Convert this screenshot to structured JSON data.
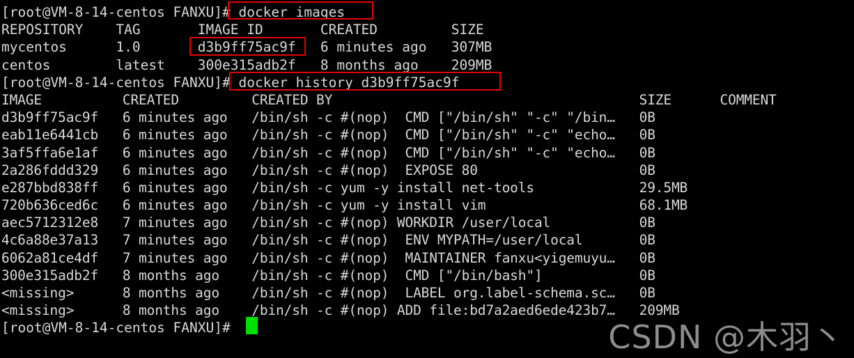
{
  "terminal": {
    "colors": {
      "background": "#000000",
      "foreground": "#d9d9d9",
      "cursor": "#00e000",
      "annotation": "#e60000",
      "watermark": "#9a9a9a"
    },
    "prompt": "[root@VM-8-14-centos FANXU]#",
    "lines": [
      "[root@VM-8-14-centos FANXU]# docker images",
      "REPOSITORY    TAG       IMAGE ID       CREATED         SIZE",
      "mycentos      1.0       d3b9ff75ac9f   6 minutes ago   307MB",
      "centos        latest    300e315adb2f   8 months ago    209MB",
      "[root@VM-8-14-centos FANXU]# docker history d3b9ff75ac9f",
      "IMAGE          CREATED         CREATED BY                                      SIZE      COMMENT",
      "d3b9ff75ac9f   6 minutes ago   /bin/sh -c #(nop)  CMD [\"/bin/sh\" \"-c\" \"/bin…   0B",
      "eab11e6441cb   6 minutes ago   /bin/sh -c #(nop)  CMD [\"/bin/sh\" \"-c\" \"echo…   0B",
      "3af5ffa6e1af   6 minutes ago   /bin/sh -c #(nop)  CMD [\"/bin/sh\" \"-c\" \"echo…   0B",
      "2a286fddd329   6 minutes ago   /bin/sh -c #(nop)  EXPOSE 80                    0B",
      "e287bbd838ff   6 minutes ago   /bin/sh -c yum -y install net-tools             29.5MB",
      "720b636ced6c   6 minutes ago   /bin/sh -c yum -y install vim                   68.1MB",
      "aec5712312e8   7 minutes ago   /bin/sh -c #(nop) WORKDIR /user/local           0B",
      "4c6a88e37a13   7 minutes ago   /bin/sh -c #(nop)  ENV MYPATH=/user/local       0B",
      "6062a81ce4df   7 minutes ago   /bin/sh -c #(nop)  MAINTAINER fanxu<yigemuyu…   0B",
      "300e315adb2f   8 months ago    /bin/sh -c #(nop)  CMD [\"/bin/bash\"]            0B",
      "<missing>      8 months ago    /bin/sh -c #(nop)  LABEL org.label-schema.sc…   0B",
      "<missing>      8 months ago    /bin/sh -c #(nop) ADD file:bd7a2aed6ede423b7…   209MB",
      "[root@VM-8-14-centos FANXU]# "
    ],
    "commands": [
      {
        "name": "docker-images",
        "text": "docker images"
      },
      {
        "name": "docker-history",
        "text": "docker history d3b9ff75ac9f"
      }
    ],
    "images_table": {
      "headers": [
        "REPOSITORY",
        "TAG",
        "IMAGE ID",
        "CREATED",
        "SIZE"
      ],
      "rows": [
        [
          "mycentos",
          "1.0",
          "d3b9ff75ac9f",
          "6 minutes ago",
          "307MB"
        ],
        [
          "centos",
          "latest",
          "300e315adb2f",
          "8 months ago",
          "209MB"
        ]
      ]
    },
    "history_table": {
      "headers": [
        "IMAGE",
        "CREATED",
        "CREATED BY",
        "SIZE",
        "COMMENT"
      ],
      "rows": [
        [
          "d3b9ff75ac9f",
          "6 minutes ago",
          "/bin/sh -c #(nop)  CMD [\"/bin/sh\" \"-c\" \"/bin…",
          "0B",
          ""
        ],
        [
          "eab11e6441cb",
          "6 minutes ago",
          "/bin/sh -c #(nop)  CMD [\"/bin/sh\" \"-c\" \"echo…",
          "0B",
          ""
        ],
        [
          "3af5ffa6e1af",
          "6 minutes ago",
          "/bin/sh -c #(nop)  CMD [\"/bin/sh\" \"-c\" \"echo…",
          "0B",
          ""
        ],
        [
          "2a286fddd329",
          "6 minutes ago",
          "/bin/sh -c #(nop)  EXPOSE 80",
          "0B",
          ""
        ],
        [
          "e287bbd838ff",
          "6 minutes ago",
          "/bin/sh -c yum -y install net-tools",
          "29.5MB",
          ""
        ],
        [
          "720b636ced6c",
          "6 minutes ago",
          "/bin/sh -c yum -y install vim",
          "68.1MB",
          ""
        ],
        [
          "aec5712312e8",
          "7 minutes ago",
          "/bin/sh -c #(nop) WORKDIR /user/local",
          "0B",
          ""
        ],
        [
          "4c6a88e37a13",
          "7 minutes ago",
          "/bin/sh -c #(nop)  ENV MYPATH=/user/local",
          "0B",
          ""
        ],
        [
          "6062a81ce4df",
          "7 minutes ago",
          "/bin/sh -c #(nop)  MAINTAINER fanxu<yigemuyu…",
          "0B",
          ""
        ],
        [
          "300e315adb2f",
          "8 months ago",
          "/bin/sh -c #(nop)  CMD [\"/bin/bash\"]",
          "0B",
          ""
        ],
        [
          "<missing>",
          "8 months ago",
          "/bin/sh -c #(nop)  LABEL org.label-schema.sc…",
          "0B",
          ""
        ],
        [
          "<missing>",
          "8 months ago",
          "/bin/sh -c #(nop) ADD file:bd7a2aed6ede423b7…",
          "209MB",
          ""
        ]
      ]
    },
    "annotations": [
      {
        "name": "docker-images-command",
        "label": "# docker images"
      },
      {
        "name": "mycentos-image-id",
        "label": "d3b9ff75ac9f"
      },
      {
        "name": "docker-history-command",
        "label": "# docker history d3b9ff75ac9f"
      }
    ],
    "watermark": "CSDN @木羽丶"
  }
}
